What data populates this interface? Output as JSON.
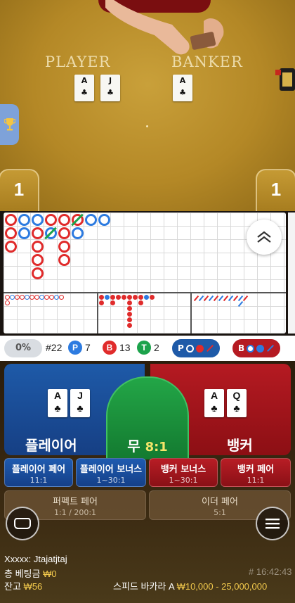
{
  "video": {
    "player_label": "PLAYER",
    "banker_label": "BANKER",
    "player_cards": [
      {
        "rank": "A",
        "suit": "♣"
      },
      {
        "rank": "J",
        "suit": "♣"
      }
    ],
    "banker_cards": [
      {
        "rank": "A",
        "suit": "♣"
      }
    ],
    "player_score": "1",
    "banker_score": "1"
  },
  "stats": {
    "percent": "0%",
    "round_label": "#22",
    "player_badge": "P",
    "player_count": "7",
    "banker_badge": "B",
    "banker_count": "13",
    "tie_badge": "T",
    "tie_count": "2",
    "ask_player": "P",
    "ask_banker": "B"
  },
  "bets": {
    "player": {
      "label": "플레이어",
      "cards": [
        {
          "rank": "A",
          "suit": "♣"
        },
        {
          "rank": "J",
          "suit": "♣"
        }
      ]
    },
    "tie": {
      "label": "무",
      "odds": "8:1"
    },
    "banker": {
      "label": "뱅커",
      "cards": [
        {
          "rank": "A",
          "suit": "♣"
        },
        {
          "rank": "Q",
          "suit": "♣"
        }
      ]
    },
    "side": [
      {
        "label": "플레이어 페어",
        "odds": "11:1"
      },
      {
        "label": "플레이어 보너스",
        "odds": "1~30:1"
      },
      {
        "label": "뱅커 보너스",
        "odds": "1~30:1"
      },
      {
        "label": "뱅커 페어",
        "odds": "11:1"
      }
    ],
    "extra": [
      {
        "label": "퍼펙트 페어",
        "odds": "1:1 / 200:1"
      },
      {
        "label": "이더 페어",
        "odds": "5:1"
      }
    ]
  },
  "footer": {
    "username": "Xxxxx: Jtajatjtaj",
    "total_bet_label": "총 베팅금",
    "total_bet_value": "₩0",
    "balance_label": "잔고",
    "balance_value": "₩56",
    "game_id": "# 16:42:43",
    "table_name": "스피드 바카라 A",
    "limits": "₩10,000 - 25,000,000"
  },
  "colors": {
    "player_blue": "#1e5aa8",
    "banker_red": "#b51a22",
    "tie_green": "#23a647",
    "accent_yellow": "#f2c94c"
  },
  "icons": {
    "trophy": "trophy-icon",
    "collapse": "chevron-up-double-icon",
    "chat": "chat-icon",
    "menu": "hamburger-menu-icon"
  }
}
